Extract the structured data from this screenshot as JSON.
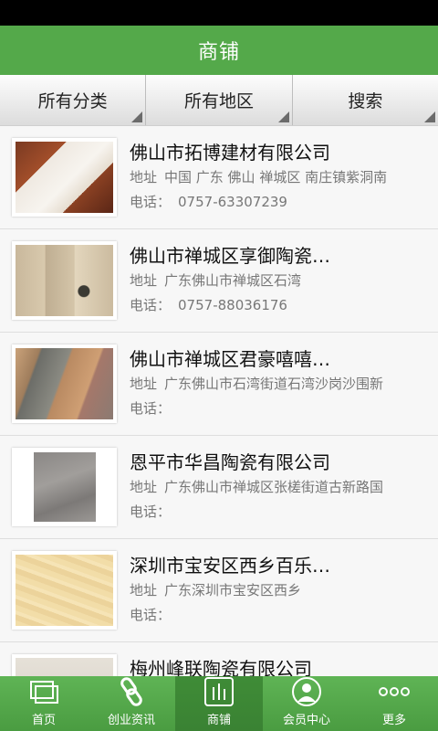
{
  "header": {
    "title": "商铺"
  },
  "filters": [
    {
      "label": "所有分类"
    },
    {
      "label": "所有地区"
    },
    {
      "label": "搜索"
    }
  ],
  "labels": {
    "address": "地址",
    "phone": "电话："
  },
  "shops": [
    {
      "name": "佛山市拓博建材有限公司",
      "address": "中国 广东 佛山 禅城区 南庄镇紫洞南",
      "phone": "0757-63307239",
      "thumb": "tile-image"
    },
    {
      "name": "佛山市禅城区享御陶瓷…",
      "address": "广东佛山市禅城区石湾",
      "phone": "0757-88036176",
      "thumb": "tile-image"
    },
    {
      "name": "佛山市禅城区君豪嘻嘻…",
      "address": "广东佛山市石湾街道石湾沙岗沙围新",
      "phone": "",
      "thumb": "tile-image"
    },
    {
      "name": "恩平市华昌陶瓷有限公司",
      "address": "广东佛山市禅城区张槎街道古新路国",
      "phone": "",
      "thumb": "tile-image"
    },
    {
      "name": "深圳市宝安区西乡百乐…",
      "address": "广东深圳市宝安区西乡",
      "phone": "",
      "thumb": "tile-image"
    },
    {
      "name": "梅州峰联陶瓷有限公司",
      "address": "",
      "phone": "",
      "thumb": "tile-image"
    }
  ],
  "nav": [
    {
      "label": "首页",
      "icon": "home-icon"
    },
    {
      "label": "创业资讯",
      "icon": "link-icon"
    },
    {
      "label": "商铺",
      "icon": "shop-icon",
      "active": true
    },
    {
      "label": "会员中心",
      "icon": "member-icon"
    },
    {
      "label": "更多",
      "icon": "more-icon"
    }
  ],
  "colors": {
    "brand_green": "#54a94a",
    "nav_active": "#3f8c37"
  }
}
